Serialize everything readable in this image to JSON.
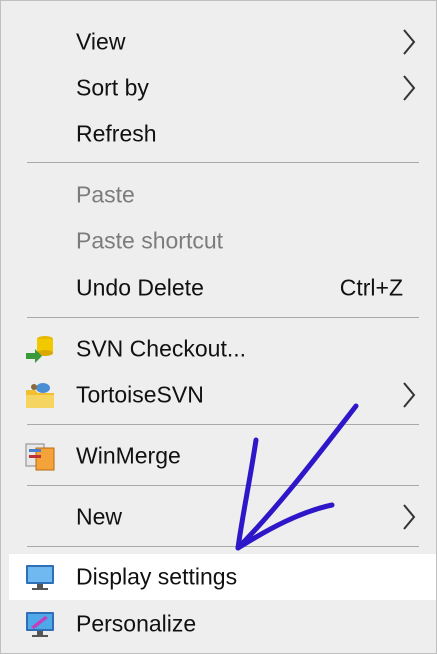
{
  "menu": {
    "items": [
      {
        "label": "View",
        "submenu": true
      },
      {
        "label": "Sort by",
        "submenu": true
      },
      {
        "label": "Refresh"
      },
      {
        "label": "Paste",
        "disabled": true
      },
      {
        "label": "Paste shortcut",
        "disabled": true
      },
      {
        "label": "Undo Delete",
        "shortcut": "Ctrl+Z"
      },
      {
        "label": "SVN Checkout...",
        "icon": "svn-checkout-icon"
      },
      {
        "label": "TortoiseSVN",
        "icon": "tortoisesvn-icon",
        "submenu": true
      },
      {
        "label": "WinMerge",
        "icon": "winmerge-icon"
      },
      {
        "label": "New",
        "submenu": true
      },
      {
        "label": "Display settings",
        "icon": "display-settings-icon",
        "highlighted": true
      },
      {
        "label": "Personalize",
        "icon": "personalize-icon"
      }
    ]
  },
  "annotation": {
    "arrow_color": "#2e16c9"
  },
  "colors": {
    "menu_background": "#eeeeee",
    "highlight_background": "#ffffff",
    "disabled_text": "#7c7c7c",
    "separator": "#a9a9a9"
  }
}
